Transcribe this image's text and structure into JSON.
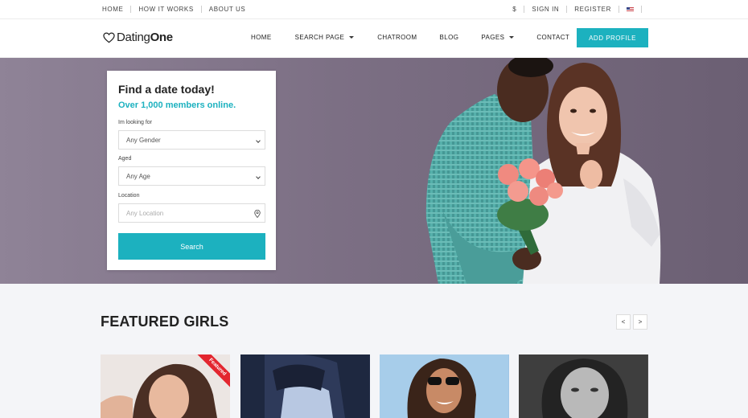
{
  "topbar": {
    "left_links": [
      "HOME",
      "HOW IT WORKS",
      "ABOUT US"
    ],
    "currency": "$",
    "sign_in": "SIGN IN",
    "register": "REGISTER",
    "language_flag": "us-flag-icon"
  },
  "nav": {
    "logo_regular": "Dating",
    "logo_bold": "One",
    "items": [
      {
        "label": "HOME",
        "dropdown": false
      },
      {
        "label": "SEARCH PAGE",
        "dropdown": true
      },
      {
        "label": "CHATROOM",
        "dropdown": false
      },
      {
        "label": "BLOG",
        "dropdown": false
      },
      {
        "label": "PAGES",
        "dropdown": true
      },
      {
        "label": "CONTACT",
        "dropdown": false
      }
    ],
    "cta": "ADD PROFILE"
  },
  "search": {
    "title": "Find a date today!",
    "subtitle": "Over 1,000 members online.",
    "gender_label": "Im looking for",
    "gender_value": "Any Gender",
    "age_label": "Aged",
    "age_value": "Any Age",
    "location_label": "Location",
    "location_placeholder": "Any Location",
    "button": "Search"
  },
  "featured": {
    "title": "FEATURED GIRLS",
    "prev": "<",
    "next": ">",
    "badge": "Featured"
  },
  "colors": {
    "accent": "#1cb1bf",
    "badge": "#e3262f",
    "hero_bg": "#7c6f84"
  }
}
